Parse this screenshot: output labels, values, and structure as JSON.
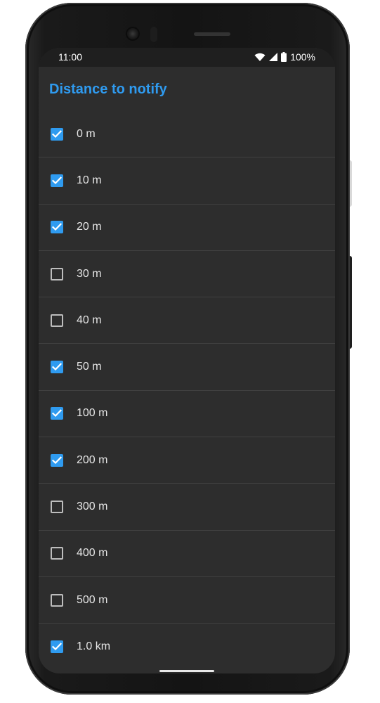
{
  "status_bar": {
    "time": "11:00",
    "battery_percent": "100%",
    "icons": [
      "wifi-icon",
      "cellular-signal-icon",
      "battery-icon"
    ]
  },
  "dialog": {
    "title": "Distance to notify",
    "options": [
      {
        "label": "0 m",
        "checked": true
      },
      {
        "label": "10 m",
        "checked": true
      },
      {
        "label": "20 m",
        "checked": true
      },
      {
        "label": "30 m",
        "checked": false
      },
      {
        "label": "40 m",
        "checked": false
      },
      {
        "label": "50 m",
        "checked": true
      },
      {
        "label": "100 m",
        "checked": true
      },
      {
        "label": "200 m",
        "checked": true
      },
      {
        "label": "300 m",
        "checked": false
      },
      {
        "label": "400 m",
        "checked": false
      },
      {
        "label": "500 m",
        "checked": false
      },
      {
        "label": "1.0 km",
        "checked": true
      }
    ]
  },
  "colors": {
    "accent": "#2f9bf0",
    "surface": "#2d2d2d",
    "status_bar": "#1f1f1f",
    "divider": "#404040",
    "text": "#e6e6e6"
  }
}
